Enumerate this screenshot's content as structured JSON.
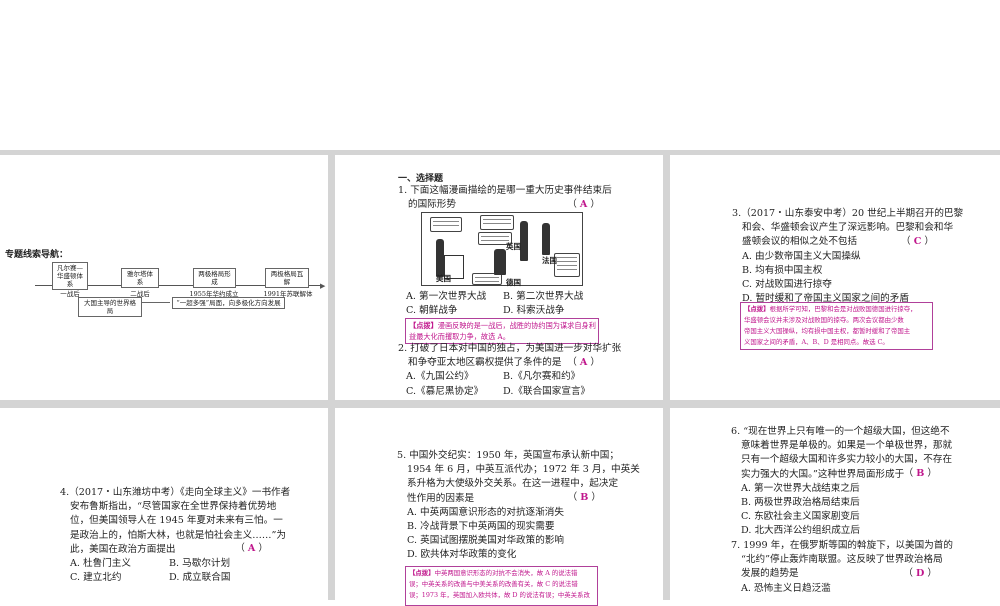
{
  "nav": {
    "title": "专题线索导航：",
    "top_boxes": [
      "凡尔赛—华盛顿体系",
      "雅尔塔体系",
      "两极格局形成",
      "两极格局瓦解"
    ],
    "timeline_labels": [
      "一战后",
      "二战后",
      "1955年华约成立",
      "1991年苏联解体"
    ],
    "bottom_boxes": [
      "大国主导的世界格局",
      "“一超多强”局面，向多极化方向发展"
    ]
  },
  "panel2": {
    "section": "一、选择题",
    "q1": {
      "lines": [
        "1. 下面这幅漫画描绘的是哪一重大历史事件结束后",
        "的国际形势"
      ],
      "answer": "A",
      "cartoon_labels": [
        "美国",
        "英国",
        "法国",
        "德国"
      ],
      "options": [
        "A. 第一次世界大战",
        "B. 第二次世界大战",
        "C. 朝鲜战争",
        "D. 科索沃战争"
      ],
      "note_tag": "【点拨】",
      "note": [
        "漫画反映的是一战后，战胜的协约国为谋求自身利",
        "益最大化而攫取力争，故选 A。"
      ]
    },
    "q2": {
      "lines": [
        "2. 打破了日本对中国的独占，为美国进一步对华扩张",
        "和争夺亚太地区霸权提供了条件的是"
      ],
      "answer": "A",
      "options": [
        "A.《九国公约》",
        "B.《凡尔赛和约》",
        "C.《慕尼黑协定》",
        "D.《联合国家宣言》"
      ]
    }
  },
  "panel3": {
    "q3": {
      "lines": [
        "3.（2017・山东泰安中考）20 世纪上半期召开的巴黎",
        "和会、华盛顿会议产生了深远影响。巴黎和会和华",
        "盛顿会议的相似之处不包括"
      ],
      "answer": "C",
      "options": [
        "A. 由少数帝国主义大国操纵",
        "B. 均有损中国主权",
        "C. 对战败国进行掠夺",
        "D. 暂时缓和了帝国主义国家之间的矛盾"
      ],
      "note_tag": "【点拨】",
      "note": [
        "根据所学可知，巴黎和会是对战败国德国进行掠夺，",
        "华盛顿会议并未涉及对战败国的掠夺。两次会议都由少数",
        "帝国主义大国操纵，均有损中国主权，都暂时缓和了帝国主",
        "义国家之间的矛盾，A、B、D 是相同点。故选 C。"
      ]
    }
  },
  "panel4": {
    "q4": {
      "lines": [
        "4.（2017・山东潍坊中考）《走向全球主义》一书作者",
        "安布鲁斯指出，“尽管国家在全世界保持着优势地",
        "位，但美国领导人在 1945 年夏对未来有三怕。一",
        "是政治上的，怕斯大林，也就是怕社会主义……”为",
        "此，美国在政治方面提出"
      ],
      "answer": "A",
      "options": [
        "A. 杜鲁门主义",
        "B. 马歇尔计划",
        "C. 建立北约",
        "D. 成立联合国"
      ]
    }
  },
  "panel5": {
    "q5": {
      "lines": [
        "5. 中国外交纪实：1950 年，英国宣布承认新中国；",
        "1954 年 6 月，中英互派代办；1972 年 3 月，中英关",
        "系升格为大使级外交关系。在这一进程中，起决定",
        "性作用的因素是"
      ],
      "answer": "B",
      "options": [
        "A. 中英两国意识形态的对抗逐渐消失",
        "B. 冷战背景下中英两国的现实需要",
        "C. 英国试图摆脱美国对华政策的影响",
        "D. 欧共体对华政策的变化"
      ],
      "note_tag": "【点拨】",
      "note": [
        "中英两国意识形态的对抗不会消失，故 A 的说法错",
        "误；中英关系的改善与中美关系的改善有关，故 C 的说法错",
        "误；1973 年，英国加入欧共体，故 D 的说法有误；中英关系改"
      ]
    }
  },
  "panel6": {
    "q6": {
      "lines": [
        "6. “现在世界上只有唯一的一个超级大国，但这绝不",
        "意味着世界是单极的。如果是一个单极世界，那就",
        "只有一个超级大国和许多实力较小的大国，不存在",
        "实力强大的大国。”这种世界局面形成于"
      ],
      "answer": "B",
      "options": [
        "A. 第一次世界大战结束之后",
        "B. 两极世界政治格局结束后",
        "C. 东欧社会主义国家剧变后",
        "D. 北大西洋公约组织成立后"
      ]
    },
    "q7": {
      "lines": [
        "7. 1999 年，在俄罗斯等国的斡旋下，以美国为首的",
        "“北约”停止轰炸南联盟。这反映了世界政治格局",
        "发展的趋势是"
      ],
      "answer": "D",
      "options": [
        "A. 恐怖主义日趋泛滥"
      ]
    }
  }
}
